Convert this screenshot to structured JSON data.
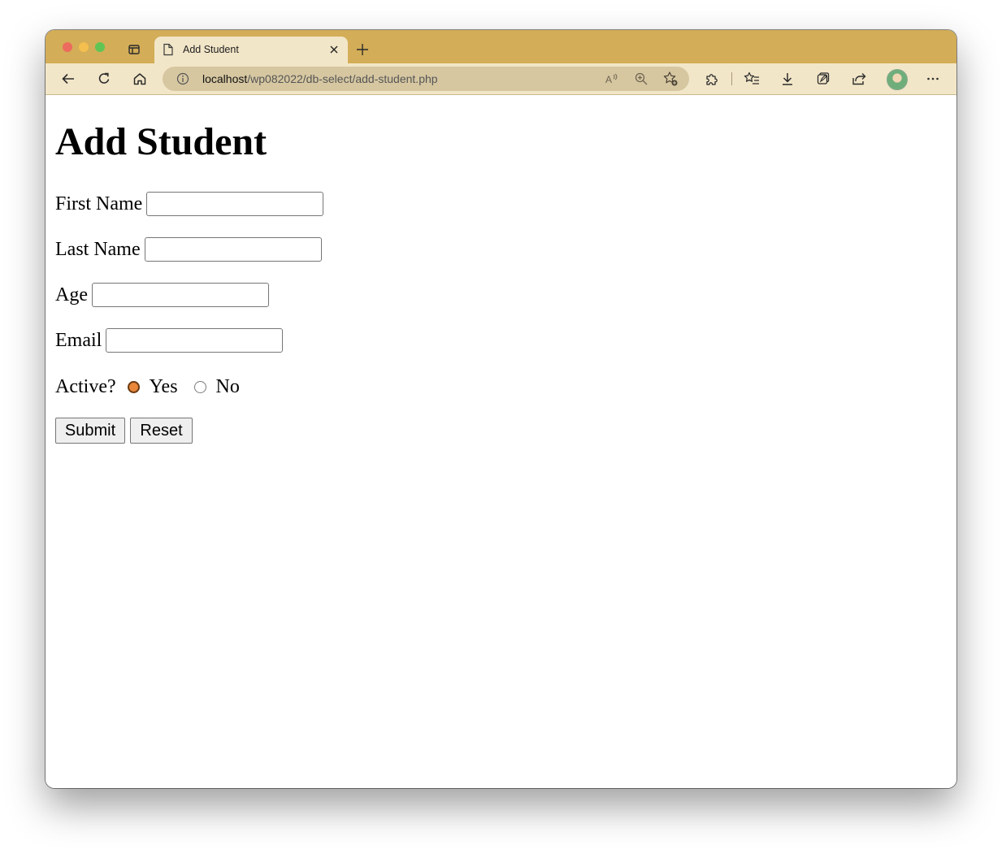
{
  "browser": {
    "tab": {
      "title": "Add Student"
    },
    "address": {
      "host": "localhost",
      "path": "/wp082022/db-select/add-student.php"
    },
    "icons": {
      "tab_actions": "tab-actions-icon",
      "page": "page-icon",
      "tab_close": "close-icon",
      "new_tab": "plus-icon",
      "back": "back-arrow-icon",
      "refresh": "refresh-icon",
      "home": "home-icon",
      "info": "info-icon",
      "read_aloud": "read-aloud-icon",
      "zoom": "zoom-icon",
      "add_favorite": "add-favorite-icon",
      "extensions": "extensions-icon",
      "favorites": "favorites-icon",
      "downloads": "download-icon",
      "collections": "collections-icon",
      "share": "share-icon",
      "profile": "avatar",
      "more": "more-icon"
    },
    "colors": {
      "frame": "#d3ad57",
      "toolbar": "#f2e6c8",
      "address_bar": "#d6c7a1"
    }
  },
  "page": {
    "heading": "Add Student",
    "fields": [
      {
        "label": "First Name",
        "value": ""
      },
      {
        "label": "Last Name",
        "value": ""
      },
      {
        "label": "Age",
        "value": ""
      },
      {
        "label": "Email",
        "value": ""
      }
    ],
    "active": {
      "label": "Active?",
      "options": [
        {
          "label": "Yes",
          "checked": true
        },
        {
          "label": "No",
          "checked": false
        }
      ]
    },
    "buttons": {
      "submit": "Submit",
      "reset": "Reset"
    }
  }
}
